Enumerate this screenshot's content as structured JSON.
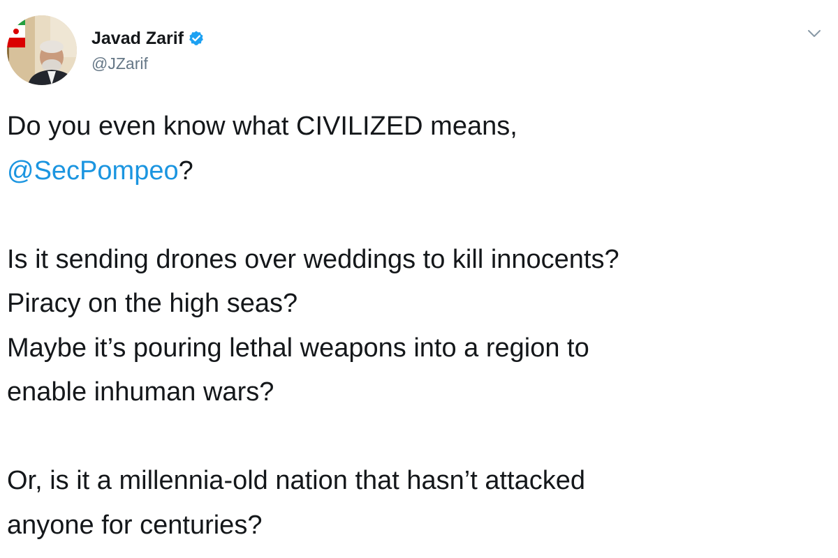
{
  "tweet": {
    "author": {
      "display_name": "Javad Zarif",
      "handle": "@JZarif",
      "verified": true
    },
    "menu_icon": "chevron-down-icon",
    "avatar_icon": "avatar",
    "body": {
      "p1_l1": "Do you even know what CIVILIZED means,",
      "p1_mention": "@SecPompeo",
      "p1_after_mention": "?",
      "p2_l1": "Is it sending drones over weddings to kill innocents?",
      "p2_l2": "Piracy on the high seas?",
      "p2_l3": "Maybe it’s pouring lethal weapons into a region to",
      "p2_l4": "enable inhuman wars?",
      "p3_l1": "Or, is it a millennia-old nation that hasn’t attacked",
      "p3_l2": "anyone for centuries?"
    },
    "colors": {
      "text": "#14171a",
      "secondary": "#657786",
      "link": "#1b95e0",
      "verified": "#1da1f2"
    }
  }
}
